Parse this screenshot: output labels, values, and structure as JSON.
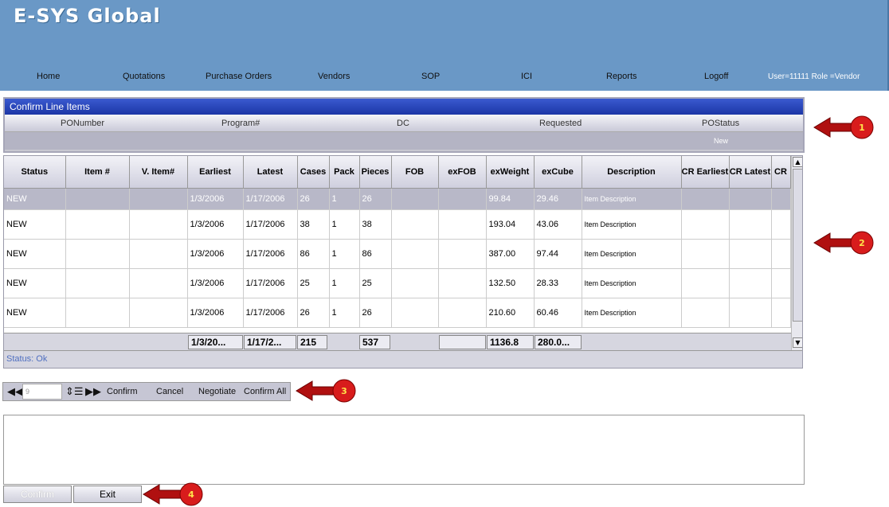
{
  "app": {
    "title": "E-SYS Global"
  },
  "nav": {
    "items": [
      "Home",
      "Quotations",
      "Purchase Orders",
      "Vendors",
      "SOP",
      "ICI",
      "Reports",
      "Logoff"
    ],
    "user": "User=11111  Role =Vendor"
  },
  "confirm_panel": {
    "title": "Confirm Line Items",
    "headers": [
      "PONumber",
      "Program#",
      "DC",
      "Requested",
      "POStatus"
    ],
    "row": {
      "po_status": "New"
    }
  },
  "grid": {
    "columns": [
      "Status",
      "Item #",
      "V. Item#",
      "Earliest",
      "Latest",
      "Cases",
      "Pack",
      "Pieces",
      "FOB",
      "exFOB",
      "exWeight",
      "exCube",
      "Description",
      "CR Earliest",
      "CR Latest",
      "CR"
    ],
    "rows": [
      {
        "status": "NEW",
        "earliest": "1/3/2006",
        "latest": "1/17/2006",
        "cases": "26",
        "pack": "1",
        "pieces": "26",
        "exweight": "99.84",
        "excube": "29.46",
        "description": "Item Description"
      },
      {
        "status": "NEW",
        "earliest": "1/3/2006",
        "latest": "1/17/2006",
        "cases": "38",
        "pack": "1",
        "pieces": "38",
        "exweight": "193.04",
        "excube": "43.06",
        "description": "Item Description"
      },
      {
        "status": "NEW",
        "earliest": "1/3/2006",
        "latest": "1/17/2006",
        "cases": "86",
        "pack": "1",
        "pieces": "86",
        "exweight": "387.00",
        "excube": "97.44",
        "description": "Item Description"
      },
      {
        "status": "NEW",
        "earliest": "1/3/2006",
        "latest": "1/17/2006",
        "cases": "25",
        "pack": "1",
        "pieces": "25",
        "exweight": "132.50",
        "excube": "28.33",
        "description": "Item Description"
      },
      {
        "status": "NEW",
        "earliest": "1/3/2006",
        "latest": "1/17/2006",
        "cases": "26",
        "pack": "1",
        "pieces": "26",
        "exweight": "210.60",
        "excube": "60.46",
        "description": "Item Description"
      }
    ],
    "totals": {
      "earliest": "1/3/20...",
      "latest": "1/17/2...",
      "cases": "215",
      "pieces": "537",
      "exweight": "1136.8",
      "excube": "280.0..."
    },
    "status_text": "Status: Ok"
  },
  "pager": {
    "page_value": "9",
    "confirm": "Confirm",
    "cancel": "Cancel",
    "negotiate": "Negotiate",
    "confirm_all": "Confirm All"
  },
  "footer": {
    "confirm": "Confirm",
    "exit": "Exit"
  },
  "callouts": [
    "1",
    "2",
    "3",
    "4"
  ],
  "colors": {
    "header_bg": "#6a98c6",
    "title_bar": "#1c36a6",
    "callout_red": "#cc1111"
  }
}
